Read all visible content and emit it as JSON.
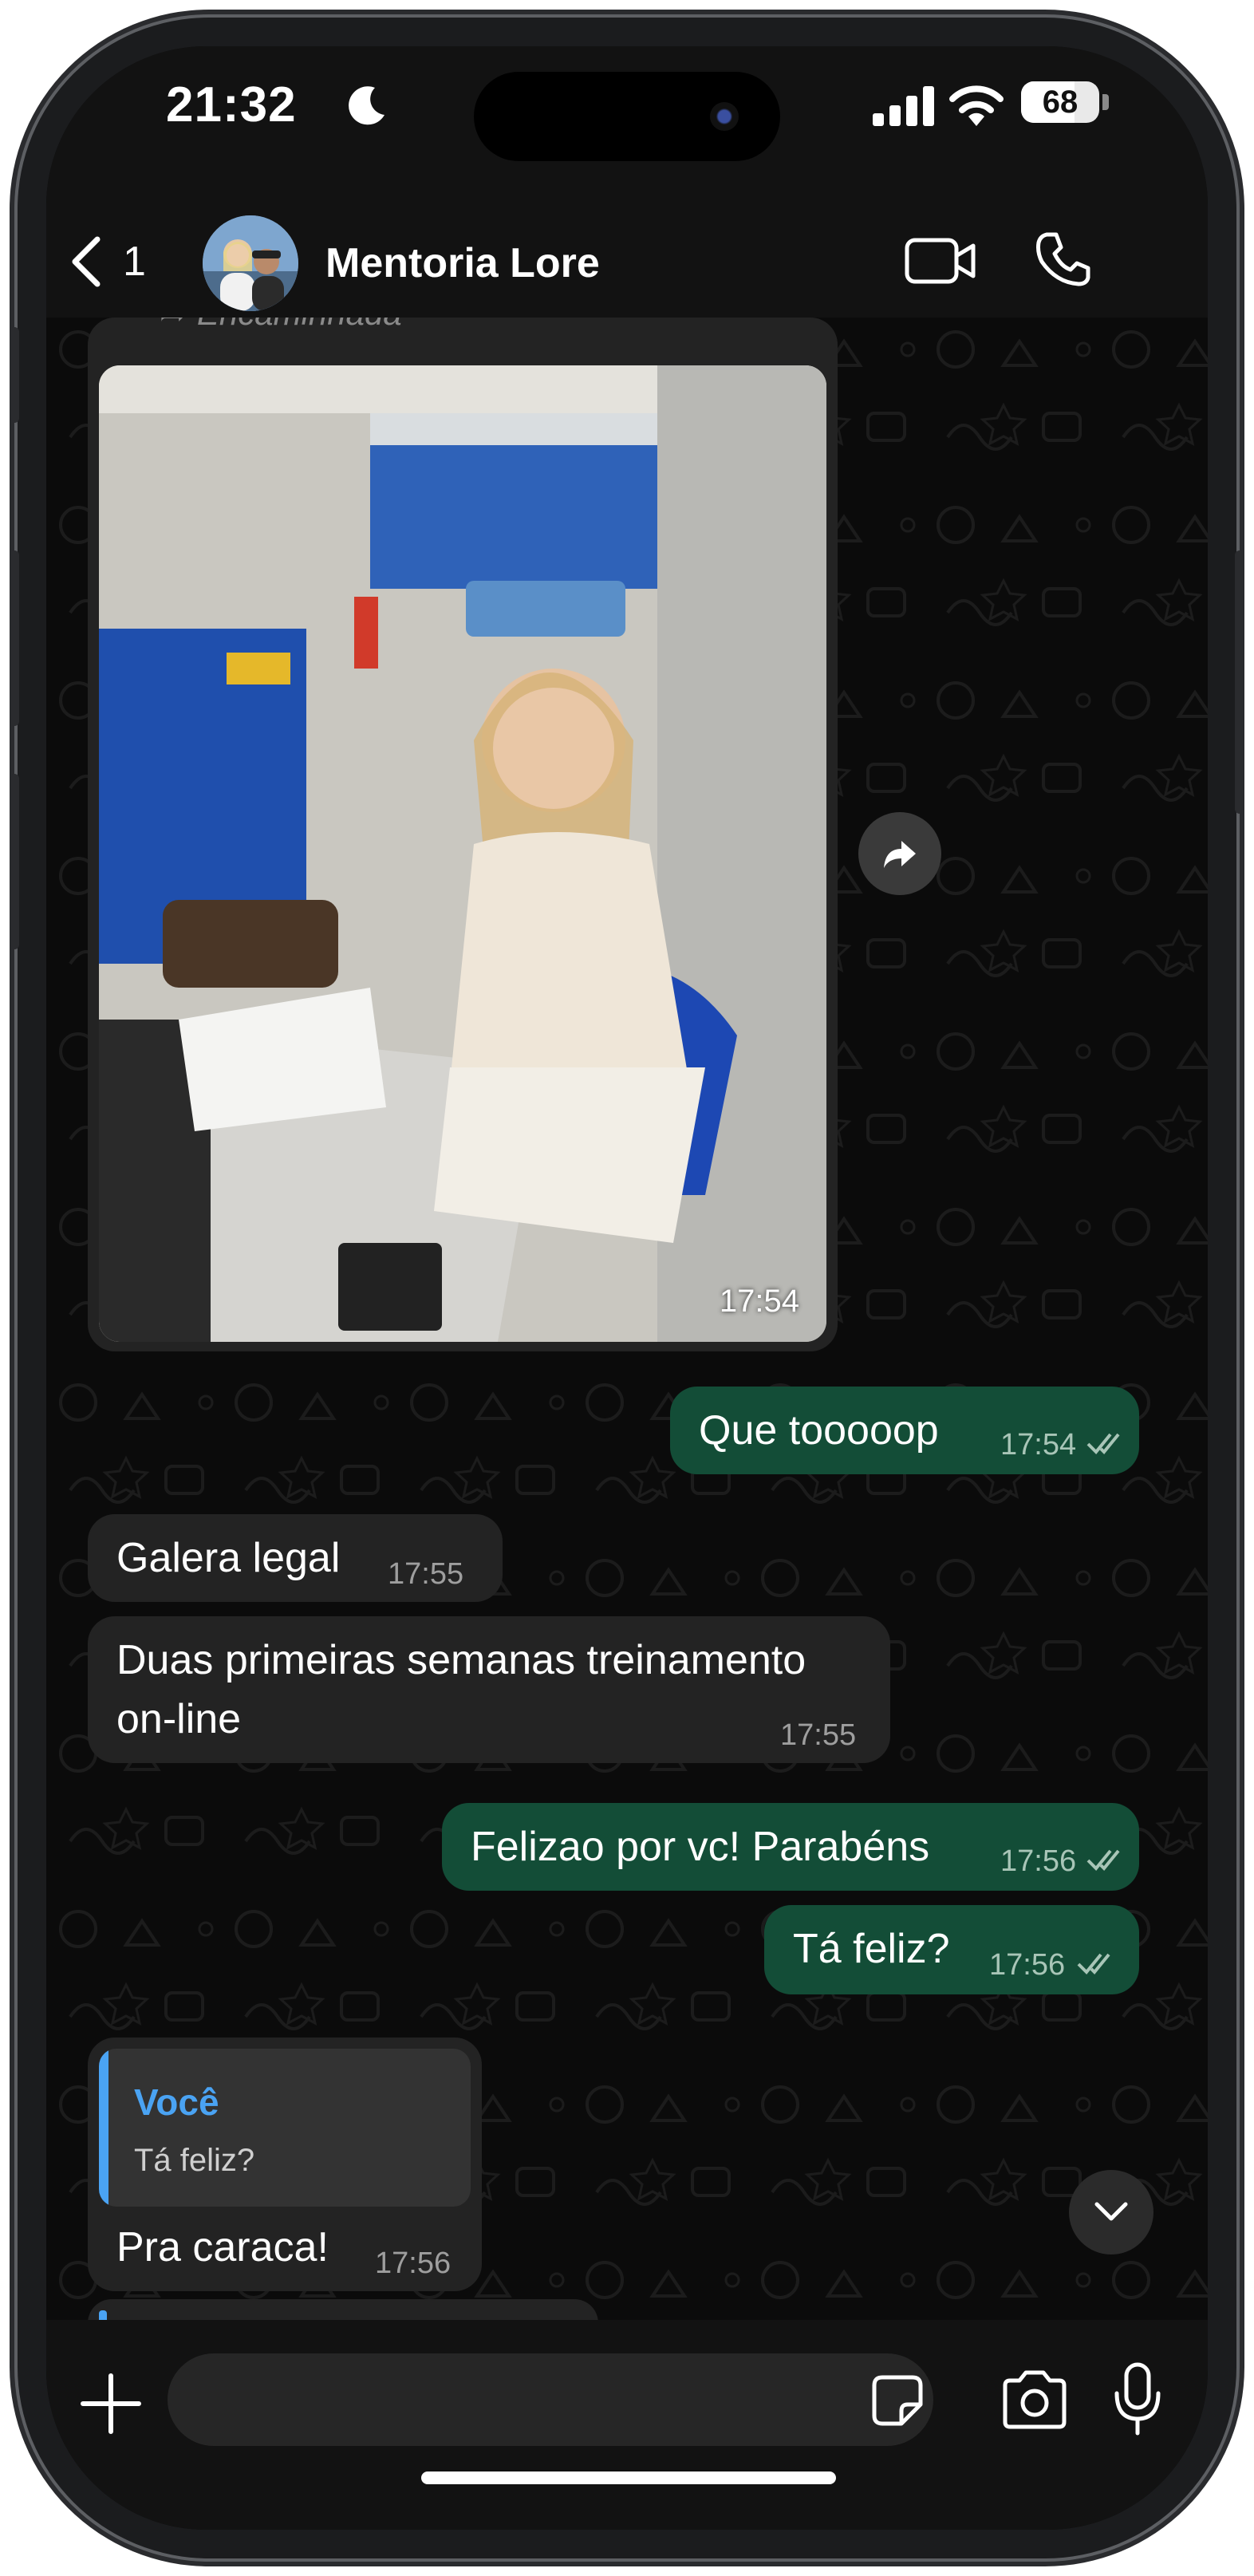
{
  "status_bar": {
    "time": "21:32",
    "battery_level": "68",
    "battery_fraction": 0.68
  },
  "header": {
    "back_count": "1",
    "chat_name": "Mentoria Lore"
  },
  "messages": {
    "forwarded_label": "Encaminhada",
    "image_time": "17:54",
    "m1": {
      "text": "Que tooooop",
      "time": "17:54"
    },
    "m2": {
      "text": "Galera legal",
      "time": "17:55"
    },
    "m3": {
      "line1": "Duas primeiras semanas treinamento",
      "line2": "on-line",
      "time": "17:55"
    },
    "m4": {
      "text": "Felizao por vc! Parabéns",
      "time": "17:56"
    },
    "m5": {
      "text": "Tá feliz?",
      "time": "17:56"
    },
    "m6": {
      "reply_author": "Você",
      "reply_text": "Tá feliz?",
      "text": "Pra caraca!",
      "time": "17:56"
    }
  },
  "input": {
    "placeholder": "",
    "value": ""
  },
  "colors": {
    "incoming_bubble": "#232323",
    "outgoing_bubble": "#134d37",
    "reply_accent": "#4aa3f3",
    "background": "#0b0b0b"
  },
  "icons": {
    "back": "chevron-left-icon",
    "video": "video-camera-icon",
    "phone": "phone-icon",
    "share": "share-icon",
    "scroll": "chevron-down-icon",
    "plus": "plus-icon",
    "sticker": "sticker-icon",
    "camera": "camera-icon",
    "mic": "microphone-icon"
  }
}
